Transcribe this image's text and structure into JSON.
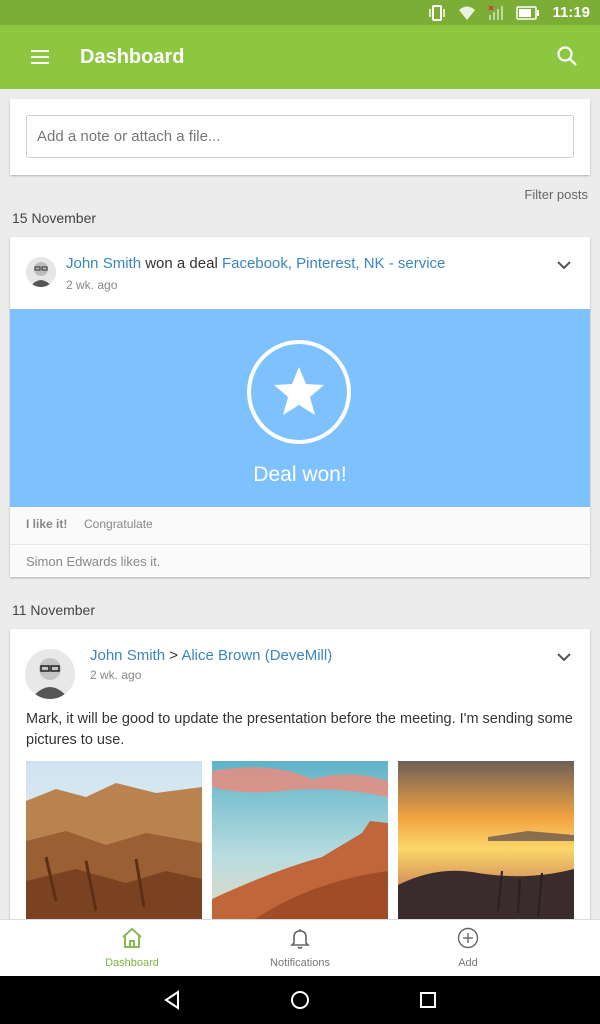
{
  "status_bar": {
    "time": "11:19"
  },
  "app_bar": {
    "title": "Dashboard"
  },
  "note": {
    "placeholder": "Add a note or attach a file..."
  },
  "feed": {
    "filter_label": "Filter posts",
    "groups": [
      {
        "date": "15 November",
        "post": {
          "author": "John Smith",
          "action": "won a deal",
          "deal_name": "Facebook, Pinterest, NK - service",
          "time": "2 wk. ago",
          "banner_text": "Deal won!",
          "actions": [
            "I like it!",
            "Congratulate"
          ],
          "likes": "Simon Edwards likes it."
        }
      },
      {
        "date": "11 November",
        "post": {
          "author": "John Smith",
          "separator": ">",
          "recipient": "Alice Brown (DeveMill)",
          "time": "2 wk. ago",
          "body": "Mark, it will be good to update the presentation before the meeting. I'm sending some pictures to use."
        }
      }
    ]
  },
  "bottom_nav": [
    {
      "label": "Dashboard",
      "icon": "home-icon",
      "active": true
    },
    {
      "label": "Notifications",
      "icon": "bell-icon",
      "active": false
    },
    {
      "label": "Add",
      "icon": "add-circle-icon",
      "active": false
    }
  ],
  "colors": {
    "primary": "#8dc63f",
    "status_bar": "#7cae37",
    "banner": "#7ec1ff",
    "link": "#3a86bf"
  }
}
